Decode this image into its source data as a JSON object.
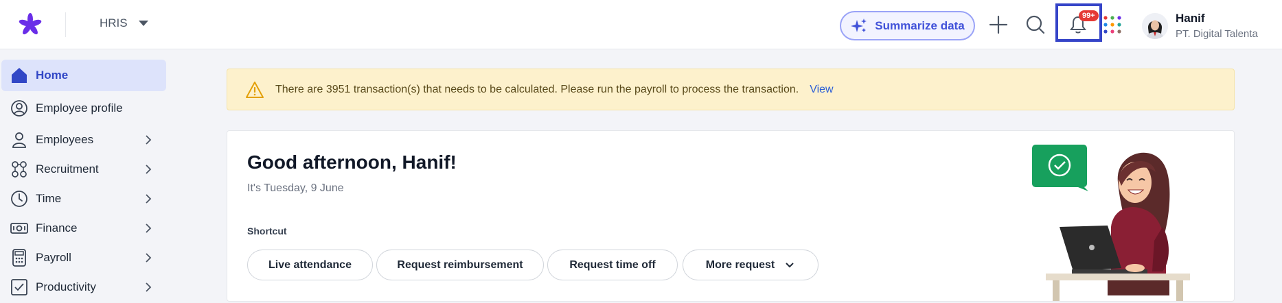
{
  "header": {
    "module": "HRIS",
    "summarize_label": "Summarize data",
    "notification_badge": "99+",
    "user": {
      "name": "Hanif",
      "company": "PT. Digital Talenta"
    }
  },
  "sidebar": {
    "items": [
      {
        "label": "Home",
        "icon": "home-icon",
        "active": true
      },
      {
        "label": "Employee profile",
        "icon": "user-circle-icon"
      },
      {
        "label": "Employees",
        "icon": "user-icon",
        "chevron": true
      },
      {
        "label": "Recruitment",
        "icon": "people-network-icon",
        "chevron": true
      },
      {
        "label": "Time",
        "icon": "clock-icon",
        "chevron": true
      },
      {
        "label": "Finance",
        "icon": "money-icon",
        "chevron": true
      },
      {
        "label": "Payroll",
        "icon": "calculator-icon",
        "chevron": true
      },
      {
        "label": "Productivity",
        "icon": "task-check-icon",
        "chevron": true
      }
    ]
  },
  "alert": {
    "text": "There are 3951 transaction(s) that needs to be calculated. Please run the payroll to process the transaction.",
    "link": "View"
  },
  "welcome": {
    "greeting": "Good afternoon, Hanif!",
    "date": "It's Tuesday, 9 June",
    "shortcut_label": "Shortcut",
    "shortcuts": [
      "Live attendance",
      "Request reimbursement",
      "Request time off",
      "More request"
    ]
  },
  "colors": {
    "brand": "#6a2ee8",
    "accent": "#3147c6",
    "alert_bg": "#fdf1cc",
    "badge": "#e53935"
  }
}
